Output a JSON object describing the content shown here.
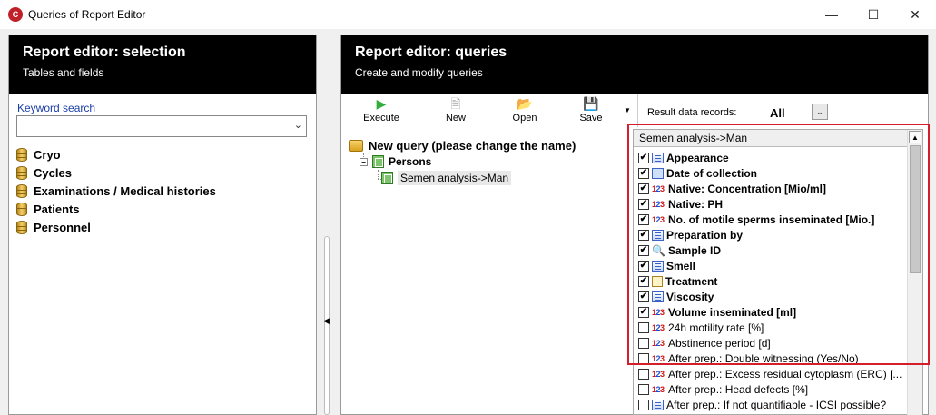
{
  "window": {
    "title": "Queries of Report Editor",
    "minimize": "—",
    "maximize": "☐",
    "close": "✕"
  },
  "left_panel": {
    "title": "Report editor: selection",
    "subtitle": "Tables and fields",
    "keyword_label": "Keyword search",
    "keyword_value": "",
    "tables": [
      "Cryo",
      "Cycles",
      "Examinations / Medical histories",
      "Patients",
      "Personnel"
    ]
  },
  "right_panel": {
    "title": "Report editor: queries",
    "subtitle": "Create and modify queries",
    "toolbar": {
      "execute": "Execute",
      "new": "New",
      "open": "Open",
      "save": "Save"
    },
    "result_label": "Result data records:",
    "result_value": "All",
    "query_tree": {
      "root": "New query (please change the name)",
      "child": "Persons",
      "grandchild": "Semen analysis->Man"
    },
    "field_list": {
      "header": "Semen analysis->Man",
      "fields": [
        {
          "label": "Appearance",
          "checked": true,
          "icon": "list"
        },
        {
          "label": "Date of collection",
          "checked": true,
          "icon": "date"
        },
        {
          "label": "Native: Concentration [Mio/ml]",
          "checked": true,
          "icon": "number"
        },
        {
          "label": "Native: PH",
          "checked": true,
          "icon": "number"
        },
        {
          "label": "No. of motile sperms inseminated [Mio.]",
          "checked": true,
          "icon": "number"
        },
        {
          "label": "Preparation by",
          "checked": true,
          "icon": "list"
        },
        {
          "label": "Sample ID",
          "checked": true,
          "icon": "key"
        },
        {
          "label": "Smell",
          "checked": true,
          "icon": "list"
        },
        {
          "label": "Treatment",
          "checked": true,
          "icon": "edit"
        },
        {
          "label": "Viscosity",
          "checked": true,
          "icon": "list"
        },
        {
          "label": "Volume inseminated [ml]",
          "checked": true,
          "icon": "number"
        },
        {
          "label": "24h motility rate [%]",
          "checked": false,
          "icon": "number"
        },
        {
          "label": "Abstinence period [d]",
          "checked": false,
          "icon": "number"
        },
        {
          "label": "After prep.: Double witnessing (Yes/No)",
          "checked": false,
          "icon": "number"
        },
        {
          "label": "After prep.: Excess residual cytoplasm (ERC) [...",
          "checked": false,
          "icon": "number"
        },
        {
          "label": "After prep.: Head defects [%]",
          "checked": false,
          "icon": "number"
        },
        {
          "label": "After prep.: If not quantifiable - ICSI possible?",
          "checked": false,
          "icon": "list"
        }
      ]
    }
  },
  "colors": {
    "highlight": "#d21f2b",
    "header_bg": "#000000",
    "link": "#1a3fa8"
  }
}
